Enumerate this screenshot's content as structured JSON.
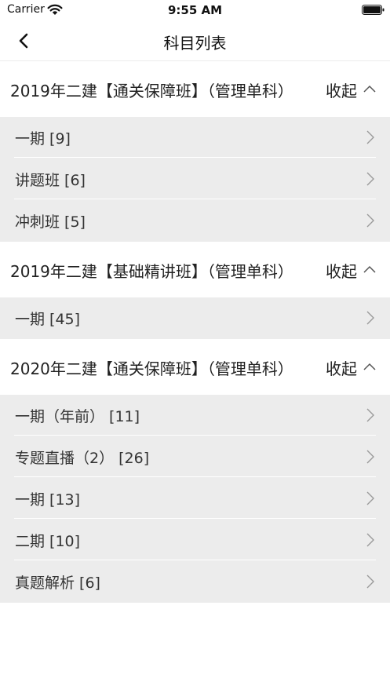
{
  "status_bar": {
    "carrier": "Carrier",
    "time": "9:55 AM"
  },
  "nav": {
    "title": "科目列表"
  },
  "sections": [
    {
      "title": "2019年二建【通关保障班】（管理单科）",
      "toggle": "收起",
      "items": [
        "一期 [9]",
        "讲题班 [6]",
        "冲刺班 [5]"
      ]
    },
    {
      "title": "2019年二建【基础精讲班】（管理单科）",
      "toggle": "收起",
      "items": [
        "一期 [45]"
      ]
    },
    {
      "title": "2020年二建【通关保障班】（管理单科）",
      "toggle": "收起",
      "items": [
        "一期（年前） [11]",
        "专题直播（2） [26]",
        "一期 [13]",
        "二期 [10]",
        "真题解析 [6]"
      ]
    }
  ],
  "icons": {
    "back": "chevron-left-icon",
    "collapse": "chevron-up-icon",
    "row": "chevron-right-icon",
    "wifi": "wifi-icon",
    "battery": "battery-icon"
  },
  "colors": {
    "section_body_bg": "#ececec",
    "row_divider": "#ffffff",
    "arrow": "#9a9a9a"
  }
}
